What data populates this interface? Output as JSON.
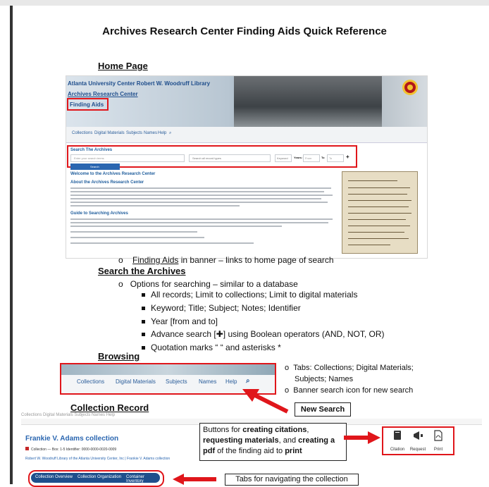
{
  "title": "Archives Research Center Finding Aids Quick Reference",
  "home": {
    "heading": "Home Page",
    "banner": {
      "line1": "Atlanta University Center Robert W. Woodruff Library",
      "line2": "Archives Research Center",
      "line3": "Finding Aids"
    },
    "nav": [
      "Collections",
      "Digital Materials",
      "Subjects",
      "Names",
      "Help"
    ],
    "search_box": {
      "heading": "Search The Archives",
      "placeholder": "Enter your search terms",
      "record_type": "Search all record types",
      "field": "Keyword",
      "years_label": "Years:",
      "from": "From",
      "to_label": "To",
      "to": "To",
      "button": "Search"
    },
    "welcome": "Welcome to the Archives Research Center",
    "about": "About the Archives Research Center",
    "guide": "Guide to Searching Archives"
  },
  "finding_aids_note": {
    "link": "Finding Aids",
    "rest": " in banner – links to home page of search"
  },
  "search": {
    "heading": "Search the Archives",
    "sub": "Options for searching – similar to a database",
    "items": [
      "All records; Limit to collections; Limit to digital materials",
      "Keyword; Title; Subject; Notes; Identifier",
      "Year [from and to]",
      "Advance search [✚] using Boolean operators (AND, NOT, OR)",
      "Quotation marks “ “ and asterisks *"
    ]
  },
  "browsing": {
    "heading": "Browsing",
    "nav": [
      "Collections",
      "Digital Materials",
      "Subjects",
      "Names",
      "Help"
    ],
    "notes": [
      "Tabs: Collections; Digital Materials;",
      "Subjects; Names",
      "Banner search icon for new search"
    ],
    "callout": "New Search"
  },
  "record": {
    "heading": "Collection Record",
    "topline": "Collections     Digital Materials     Subjects     Names     Help",
    "title": "Frankie V. Adams collection",
    "meta": "Collection — Box: 1-5   Identifier: 0000-0000-0020-0009",
    "breadcrumb": "Robert W. Woodruff Library of the Atlanta University Center, Inc  |  Frankie V. Adams collection",
    "callout_parts": [
      "Buttons for ",
      "creating citations",
      ", ",
      "requesting materials",
      ", and ",
      "creating a pdf",
      " of the finding aid to ",
      "print"
    ],
    "icons": [
      {
        "name": "citation-icon",
        "label": "Citation"
      },
      {
        "name": "request-icon",
        "label": "Request"
      },
      {
        "name": "print-icon",
        "label": "Print"
      }
    ],
    "tabs": [
      "Collection Overview",
      "Collection Organization",
      "Container Inventory"
    ],
    "tabs_callout": "Tabs for navigating the collection"
  },
  "colors": {
    "red": "#e0161b",
    "link_blue": "#2a5d9a",
    "tab_blue": "#1f4f8c"
  }
}
